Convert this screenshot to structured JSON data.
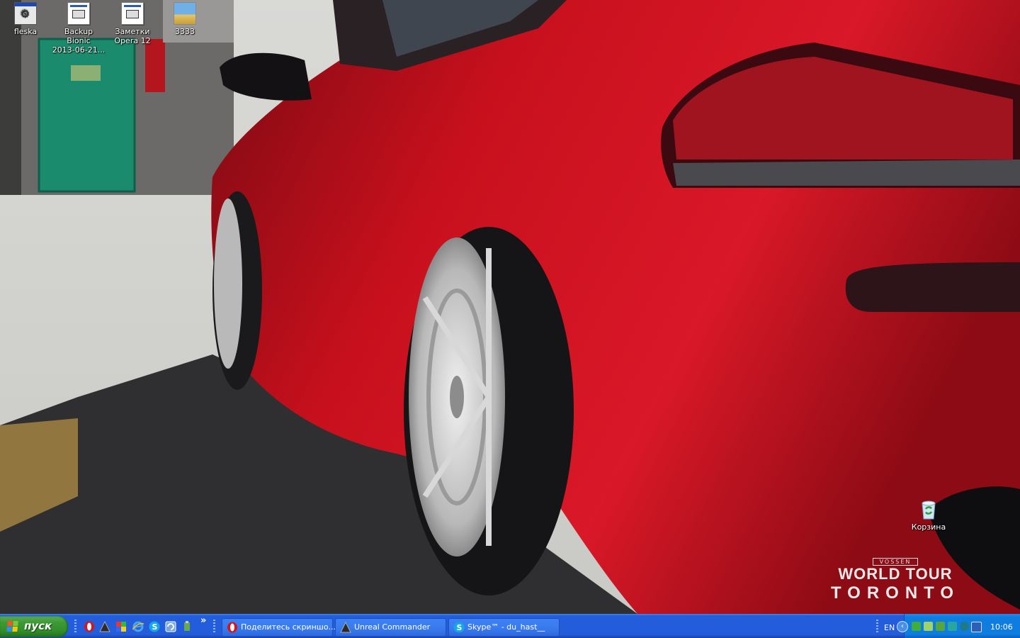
{
  "desktop": {
    "icons": [
      {
        "label_line1": "fleska",
        "label_line2": "",
        "icon": "exe-app-icon"
      },
      {
        "label_line1": "Backup Bionic",
        "label_line2": "2013-06-21...",
        "icon": "document-icon"
      },
      {
        "label_line1": "Заметки",
        "label_line2": "Opera 12",
        "icon": "document-icon"
      },
      {
        "label_line1": "3333",
        "label_line2": "",
        "icon": "image-file-icon"
      }
    ],
    "recycle_bin": {
      "label": "Корзина",
      "icon": "recycle-bin-icon"
    },
    "wallpaper": {
      "brand": "VOSSEN",
      "line1": "WORLD TOUR",
      "line2": "TORONTO"
    }
  },
  "taskbar": {
    "start_label": "пуск",
    "quick_launch": [
      "opera-icon",
      "unreal-commander-icon",
      "picasa-icon",
      "internet-explorer-icon",
      "skype-icon",
      "refresh-tool-icon",
      "usb-tool-icon"
    ],
    "overflow_glyph": "»",
    "tasks": [
      {
        "label": "Поделитесь скриншо...",
        "icon": "opera-icon"
      },
      {
        "label": "Unreal Commander",
        "icon": "unreal-commander-icon"
      },
      {
        "label": "Skype™ - du_hast__",
        "icon": "skype-icon"
      }
    ],
    "language": "EN",
    "clock": "10:06"
  },
  "colors": {
    "taskbar": "#245ddb",
    "start": "#3c9a34",
    "tray": "#0f7ce0",
    "car_red": "#c8101d"
  }
}
